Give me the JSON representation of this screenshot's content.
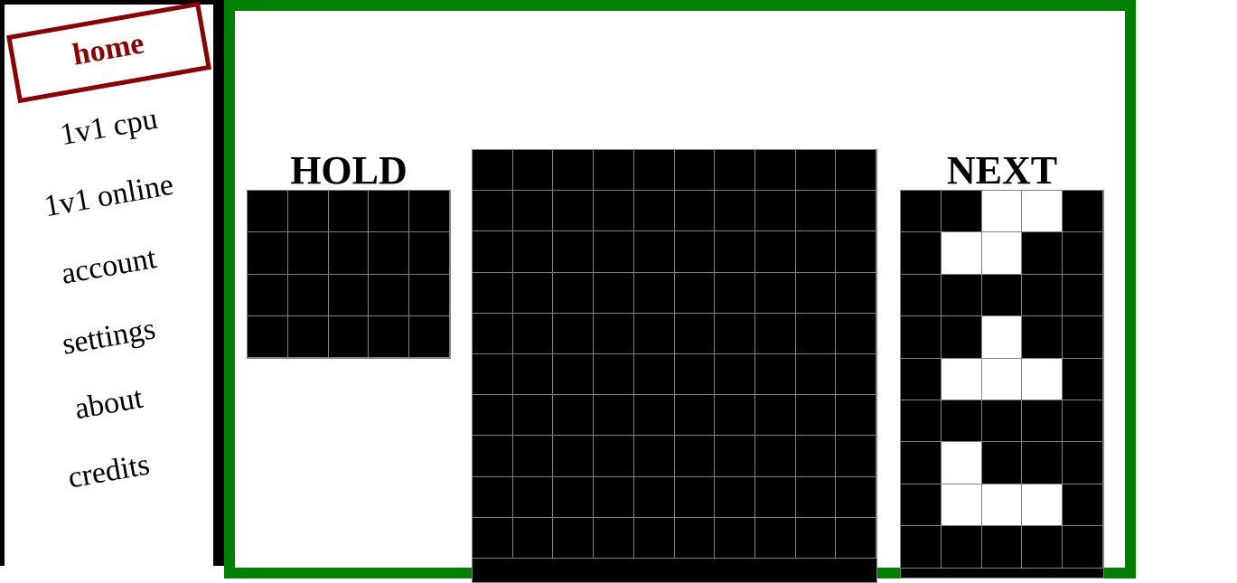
{
  "nav": {
    "items": [
      {
        "label": "home",
        "active": true
      },
      {
        "label": "1v1 cpu",
        "active": false
      },
      {
        "label": "1v1 online",
        "active": false
      },
      {
        "label": "account",
        "active": false
      },
      {
        "label": "settings",
        "active": false
      },
      {
        "label": "about",
        "active": false
      },
      {
        "label": "credits",
        "active": false
      }
    ]
  },
  "game": {
    "hold": {
      "title": "HOLD",
      "cols": 5,
      "rows": 4,
      "filled": []
    },
    "board": {
      "cols": 10,
      "rows_visible": 10,
      "filled": []
    },
    "next": {
      "title": "NEXT",
      "cols": 5,
      "rows": 9,
      "filled": [
        [
          0,
          2
        ],
        [
          0,
          3
        ],
        [
          1,
          1
        ],
        [
          1,
          2
        ],
        [
          3,
          2
        ],
        [
          4,
          1
        ],
        [
          4,
          2
        ],
        [
          4,
          3
        ],
        [
          6,
          1
        ],
        [
          7,
          1
        ],
        [
          7,
          2
        ],
        [
          7,
          3
        ]
      ]
    }
  },
  "colors": {
    "frame": "#008000",
    "active_nav": "#8b0000",
    "cell_empty": "#000000",
    "cell_filled": "#ffffff",
    "grid_lines": "#808080"
  }
}
